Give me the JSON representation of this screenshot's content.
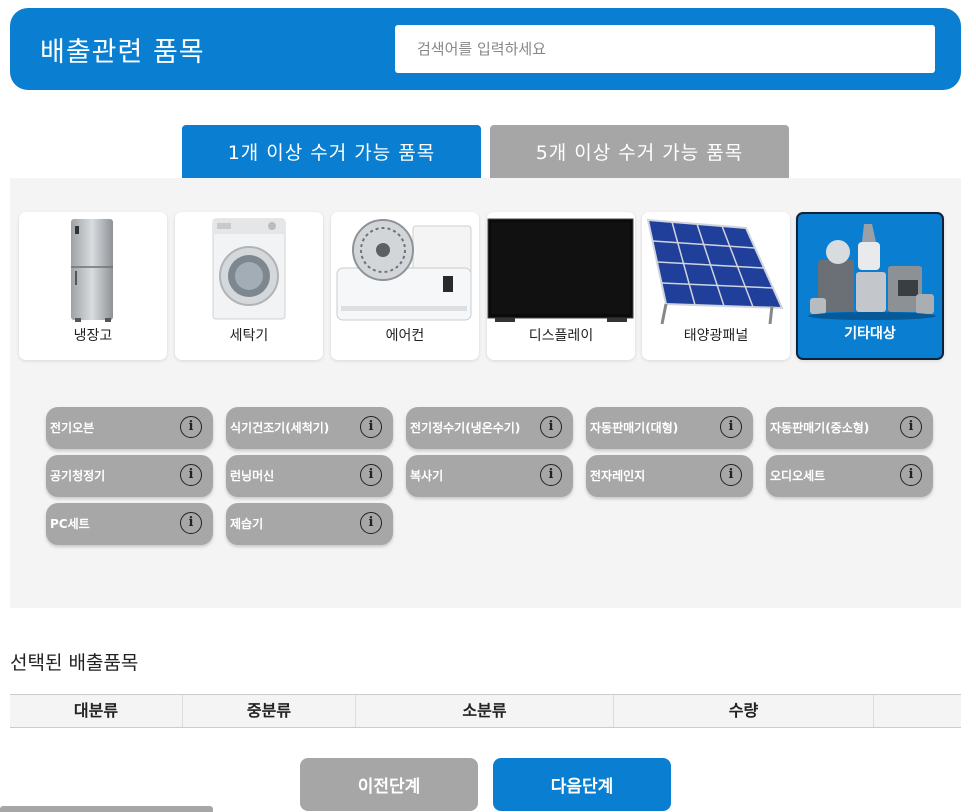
{
  "header": {
    "title": "배출관련 품목",
    "search_placeholder": "검색어를 입력하세요"
  },
  "tabs": [
    {
      "label": "1개 이상 수거 가능 품목",
      "active": true
    },
    {
      "label": "5개 이상 수거 가능 품목",
      "active": false
    }
  ],
  "categories": [
    {
      "label": "냉장고",
      "icon": "refrigerator-icon"
    },
    {
      "label": "세탁기",
      "icon": "washing-machine-icon"
    },
    {
      "label": "에어컨",
      "icon": "air-conditioner-icon"
    },
    {
      "label": "디스플레이",
      "icon": "display-icon"
    },
    {
      "label": "태양광패널",
      "icon": "solar-panel-icon"
    },
    {
      "label": "기타대상",
      "icon": "misc-appliances-icon",
      "active": true
    }
  ],
  "items": [
    {
      "label": "전기오븐"
    },
    {
      "label": "식기건조기(세척기)"
    },
    {
      "label": "전기정수기(냉온수기)"
    },
    {
      "label": "자동판매기(대형)"
    },
    {
      "label": "자동판매기(중소형)"
    },
    {
      "label": "공기청정기"
    },
    {
      "label": "런닝머신"
    },
    {
      "label": "복사기"
    },
    {
      "label": "전자레인지"
    },
    {
      "label": "오디오세트"
    },
    {
      "label": "PC세트"
    },
    {
      "label": "제습기"
    }
  ],
  "info_icon_glyph": "i",
  "selected": {
    "title": "선택된 배출품목",
    "columns": [
      "대분류",
      "중분류",
      "소분류",
      "수량"
    ]
  },
  "buttons": {
    "prev": "이전단계",
    "next": "다음단계"
  },
  "colors": {
    "accent": "#0a7fd1",
    "inactive": "#a6a6a6",
    "panel": "#f4f4f4"
  }
}
